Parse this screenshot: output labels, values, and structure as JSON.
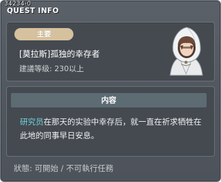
{
  "window": {
    "quest_id": "34234-0",
    "title": "QUEST INFO"
  },
  "header": {
    "badge_label": "主要",
    "npc_name": "[莫拉斯]孤独的幸存者",
    "level_requirement": "建議等级: 230以上",
    "npc_icon": "hooded-npc-portrait"
  },
  "content": {
    "header_label": "内容",
    "highlight_text": "研究员",
    "body_text": "在那天的实验中幸存后，就一直在祈求牺牲在此地的同事早日安息。"
  },
  "status": {
    "text": "狀態: 可開始 / 不可執行任務"
  },
  "colors": {
    "window_bg": "#565c63",
    "panel_bg": "#454a50",
    "badge_bg": "#d6c19e",
    "content_header_bg": "#5d6b73",
    "highlight": "#6fd2dd"
  }
}
